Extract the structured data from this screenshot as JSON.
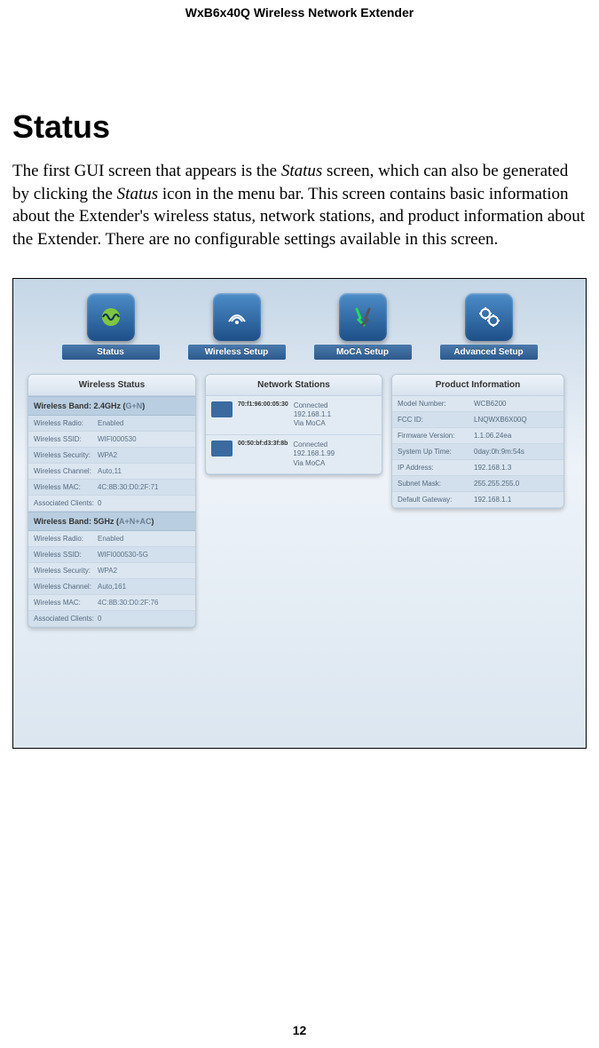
{
  "header": "WxB6x40Q Wireless Network Extender",
  "title": "Status",
  "para_pre": "The first GUI screen that appears is the ",
  "para_em1": "Status",
  "para_mid1": " screen, which can also be generated by clicking the ",
  "para_em2": "Status",
  "para_mid2": " icon in the menu bar. This screen contains basic information about the Extender's wireless status, network stations, and product information about the Extender. There are no configurable settings available in this screen.",
  "page_num": "12",
  "menu": {
    "status": "Status",
    "wireless": "Wireless Setup",
    "moca": "MoCA Setup",
    "advanced": "Advanced Setup"
  },
  "panels": {
    "wireless_status": "Wireless Status",
    "network_stations": "Network Stations",
    "product_info": "Product Information"
  },
  "band24": {
    "header_main": "Wireless Band: 2.4GHz (",
    "header_sub": "G+N",
    "header_end": ")",
    "rows": [
      {
        "k": "Wireless Radio:",
        "v": "Enabled"
      },
      {
        "k": "Wireless SSID:",
        "v": "WIFI000530"
      },
      {
        "k": "Wireless Security:",
        "v": "WPA2"
      },
      {
        "k": "Wireless Channel:",
        "v": "Auto,11"
      },
      {
        "k": "Wireless MAC:",
        "v": "4C:8B:30:D0:2F:71"
      },
      {
        "k": "Associated Clients:",
        "v": "0"
      }
    ]
  },
  "band5": {
    "header_main": "Wireless Band: 5GHz (",
    "header_sub": "A+N+AC",
    "header_end": ")",
    "rows": [
      {
        "k": "Wireless Radio:",
        "v": "Enabled"
      },
      {
        "k": "Wireless SSID:",
        "v": "WIFI000530-5G"
      },
      {
        "k": "Wireless Security:",
        "v": "WPA2"
      },
      {
        "k": "Wireless Channel:",
        "v": "Auto,161"
      },
      {
        "k": "Wireless MAC:",
        "v": "4C:8B:30:D0:2F:76"
      },
      {
        "k": "Associated Clients:",
        "v": "0"
      }
    ]
  },
  "stations": [
    {
      "mac": "70:f1:96:00:05:30",
      "status": "Connected",
      "ip": "192.168.1.1",
      "via": "Via MoCA"
    },
    {
      "mac": "00:50:bf:d3:3f:8b",
      "status": "Connected",
      "ip": "192.168.1.99",
      "via": "Via MoCA"
    }
  ],
  "product": [
    {
      "k": "Model Number:",
      "v": "WCB6200"
    },
    {
      "k": "FCC ID:",
      "v": "LNQWXB6X00Q"
    },
    {
      "k": "Firmware Version:",
      "v": "1.1.06.24ea"
    },
    {
      "k": "System Up Time:",
      "v": "0day:0h:9m:54s"
    },
    {
      "k": "IP Address:",
      "v": "192.168.1.3"
    },
    {
      "k": "Subnet Mask:",
      "v": "255.255.255.0"
    },
    {
      "k": "Default Gateway:",
      "v": "192.168.1.1"
    }
  ]
}
